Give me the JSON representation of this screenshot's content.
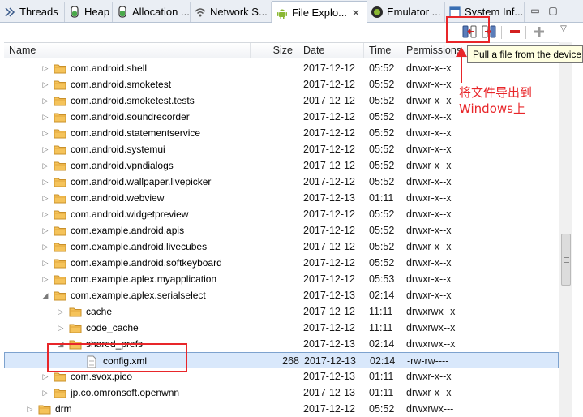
{
  "tabs": [
    {
      "label": "Threads",
      "icon": "threads-icon"
    },
    {
      "label": "Heap",
      "icon": "heap-icon"
    },
    {
      "label": "Allocation ...",
      "icon": "allocation-icon"
    },
    {
      "label": "Network S...",
      "icon": "network-icon"
    },
    {
      "label": "File Explo...",
      "icon": "android-icon",
      "active": true
    },
    {
      "label": "Emulator ...",
      "icon": "emulator-icon"
    },
    {
      "label": "System Inf...",
      "icon": "system-info-icon"
    }
  ],
  "toolbar": {
    "pull_tooltip": "Pull a file from the device",
    "pull_icon": "pull-file-icon",
    "push_icon": "push-file-icon",
    "delete_icon": "delete-icon",
    "new_folder_icon": "add-icon"
  },
  "columns": {
    "name": "Name",
    "size": "Size",
    "date": "Date",
    "time": "Time",
    "permissions": "Permissions"
  },
  "rows": [
    {
      "name": "com.android.shell",
      "size": "",
      "date": "2017-12-12",
      "time": "05:52",
      "perm": "drwxr-x--x",
      "level": 2,
      "type": "folder",
      "expand": "collapsed"
    },
    {
      "name": "com.android.smoketest",
      "size": "",
      "date": "2017-12-12",
      "time": "05:52",
      "perm": "drwxr-x--x",
      "level": 2,
      "type": "folder",
      "expand": "collapsed"
    },
    {
      "name": "com.android.smoketest.tests",
      "size": "",
      "date": "2017-12-12",
      "time": "05:52",
      "perm": "drwxr-x--x",
      "level": 2,
      "type": "folder",
      "expand": "collapsed"
    },
    {
      "name": "com.android.soundrecorder",
      "size": "",
      "date": "2017-12-12",
      "time": "05:52",
      "perm": "drwxr-x--x",
      "level": 2,
      "type": "folder",
      "expand": "collapsed"
    },
    {
      "name": "com.android.statementservice",
      "size": "",
      "date": "2017-12-12",
      "time": "05:52",
      "perm": "drwxr-x--x",
      "level": 2,
      "type": "folder",
      "expand": "collapsed"
    },
    {
      "name": "com.android.systemui",
      "size": "",
      "date": "2017-12-12",
      "time": "05:52",
      "perm": "drwxr-x--x",
      "level": 2,
      "type": "folder",
      "expand": "collapsed"
    },
    {
      "name": "com.android.vpndialogs",
      "size": "",
      "date": "2017-12-12",
      "time": "05:52",
      "perm": "drwxr-x--x",
      "level": 2,
      "type": "folder",
      "expand": "collapsed"
    },
    {
      "name": "com.android.wallpaper.livepicker",
      "size": "",
      "date": "2017-12-12",
      "time": "05:52",
      "perm": "drwxr-x--x",
      "level": 2,
      "type": "folder",
      "expand": "collapsed"
    },
    {
      "name": "com.android.webview",
      "size": "",
      "date": "2017-12-13",
      "time": "01:11",
      "perm": "drwxr-x--x",
      "level": 2,
      "type": "folder",
      "expand": "collapsed"
    },
    {
      "name": "com.android.widgetpreview",
      "size": "",
      "date": "2017-12-12",
      "time": "05:52",
      "perm": "drwxr-x--x",
      "level": 2,
      "type": "folder",
      "expand": "collapsed"
    },
    {
      "name": "com.example.android.apis",
      "size": "",
      "date": "2017-12-12",
      "time": "05:52",
      "perm": "drwxr-x--x",
      "level": 2,
      "type": "folder",
      "expand": "collapsed"
    },
    {
      "name": "com.example.android.livecubes",
      "size": "",
      "date": "2017-12-12",
      "time": "05:52",
      "perm": "drwxr-x--x",
      "level": 2,
      "type": "folder",
      "expand": "collapsed"
    },
    {
      "name": "com.example.android.softkeyboard",
      "size": "",
      "date": "2017-12-12",
      "time": "05:52",
      "perm": "drwxr-x--x",
      "level": 2,
      "type": "folder",
      "expand": "collapsed"
    },
    {
      "name": "com.example.aplex.myapplication",
      "size": "",
      "date": "2017-12-12",
      "time": "05:53",
      "perm": "drwxr-x--x",
      "level": 2,
      "type": "folder",
      "expand": "collapsed"
    },
    {
      "name": "com.example.aplex.serialselect",
      "size": "",
      "date": "2017-12-13",
      "time": "02:14",
      "perm": "drwxr-x--x",
      "level": 2,
      "type": "folder",
      "expand": "expanded"
    },
    {
      "name": "cache",
      "size": "",
      "date": "2017-12-12",
      "time": "11:11",
      "perm": "drwxrwx--x",
      "level": 3,
      "type": "folder",
      "expand": "collapsed"
    },
    {
      "name": "code_cache",
      "size": "",
      "date": "2017-12-12",
      "time": "11:11",
      "perm": "drwxrwx--x",
      "level": 3,
      "type": "folder",
      "expand": "collapsed"
    },
    {
      "name": "shared_prefs",
      "size": "",
      "date": "2017-12-13",
      "time": "02:14",
      "perm": "drwxrwx--x",
      "level": 3,
      "type": "folder",
      "expand": "expanded"
    },
    {
      "name": "config.xml",
      "size": "268",
      "date": "2017-12-13",
      "time": "02:14",
      "perm": "-rw-rw----",
      "level": 4,
      "type": "file",
      "expand": "none",
      "selected": true
    },
    {
      "name": "com.svox.pico",
      "size": "",
      "date": "2017-12-13",
      "time": "01:11",
      "perm": "drwxr-x--x",
      "level": 2,
      "type": "folder",
      "expand": "collapsed"
    },
    {
      "name": "jp.co.omronsoft.openwnn",
      "size": "",
      "date": "2017-12-13",
      "time": "01:11",
      "perm": "drwxr-x--x",
      "level": 2,
      "type": "folder",
      "expand": "collapsed"
    },
    {
      "name": "drm",
      "size": "",
      "date": "2017-12-12",
      "time": "05:52",
      "perm": "drwxrwx---",
      "level": 1,
      "type": "folder",
      "expand": "collapsed"
    }
  ],
  "annotation": {
    "text_line1": "将文件导出到",
    "text_line2": "Windows上",
    "color": "#e8262a"
  },
  "colors": {
    "folder": "#f0b84a",
    "selection": "#d9e8fb",
    "delete": "#d32020",
    "add": "#9a9a9a"
  }
}
